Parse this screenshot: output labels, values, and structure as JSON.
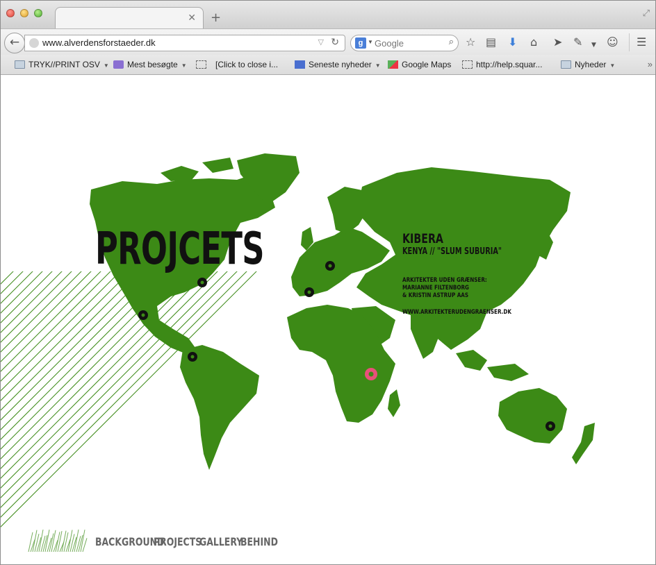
{
  "browser": {
    "url": "www.alverdensforstaeder.dk",
    "search_placeholder": "Google",
    "bookmarks": [
      {
        "label": "TRYK//PRINT OSV"
      },
      {
        "label": "Mest besøgte"
      },
      {
        "label": "[Click to close i..."
      },
      {
        "label": "Seneste nyheder"
      },
      {
        "label": "Google Maps"
      },
      {
        "label": "http://help.squar..."
      },
      {
        "label": "Nyheder"
      }
    ]
  },
  "page": {
    "title": "PROJCETS",
    "project": {
      "name": "KIBERA",
      "subtitle": "KENYA  //   \"SLUM SUBURIA\"",
      "credits": [
        "ARKITEKTER UDEN GRÆNSER:",
        "MARIANNE FILTENBORG",
        "& KRISTIN ASTRUP AAS"
      ],
      "website": "WWW.ARKITEKTERUDENGRAENSER.DK"
    },
    "nav": [
      "BACKGROUND",
      "PROJECTS",
      "GALLERY",
      "BEHIND"
    ],
    "colors": {
      "land": "#3c8a16",
      "marker": "#111111",
      "active_marker": "#e8507a",
      "hatch": "#3c8a16"
    }
  }
}
